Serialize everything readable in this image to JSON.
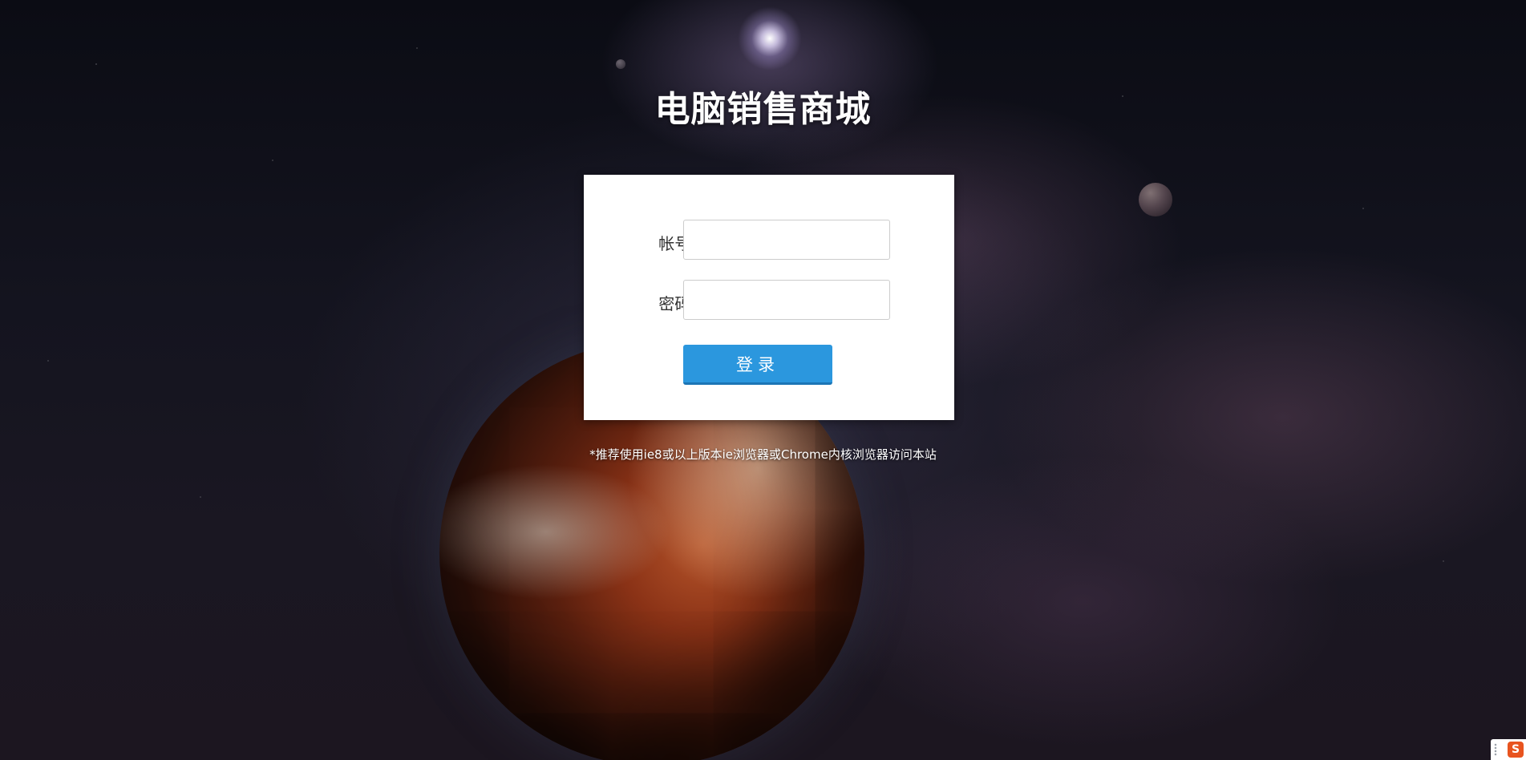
{
  "page": {
    "title": "电脑销售商城",
    "hint": "*推荐使用ie8或以上版本ie浏览器或Chrome内核浏览器访问本站"
  },
  "login": {
    "account_label": "帐号:",
    "account_value": "",
    "password_label": "密码:",
    "password_value": "",
    "button_label": "登录"
  },
  "corner": {
    "logo_glyph": "S",
    "icon": "sogou-input-icon"
  },
  "colors": {
    "button": "#2b97de",
    "panel": "#ffffff",
    "title": "#ffffff"
  }
}
